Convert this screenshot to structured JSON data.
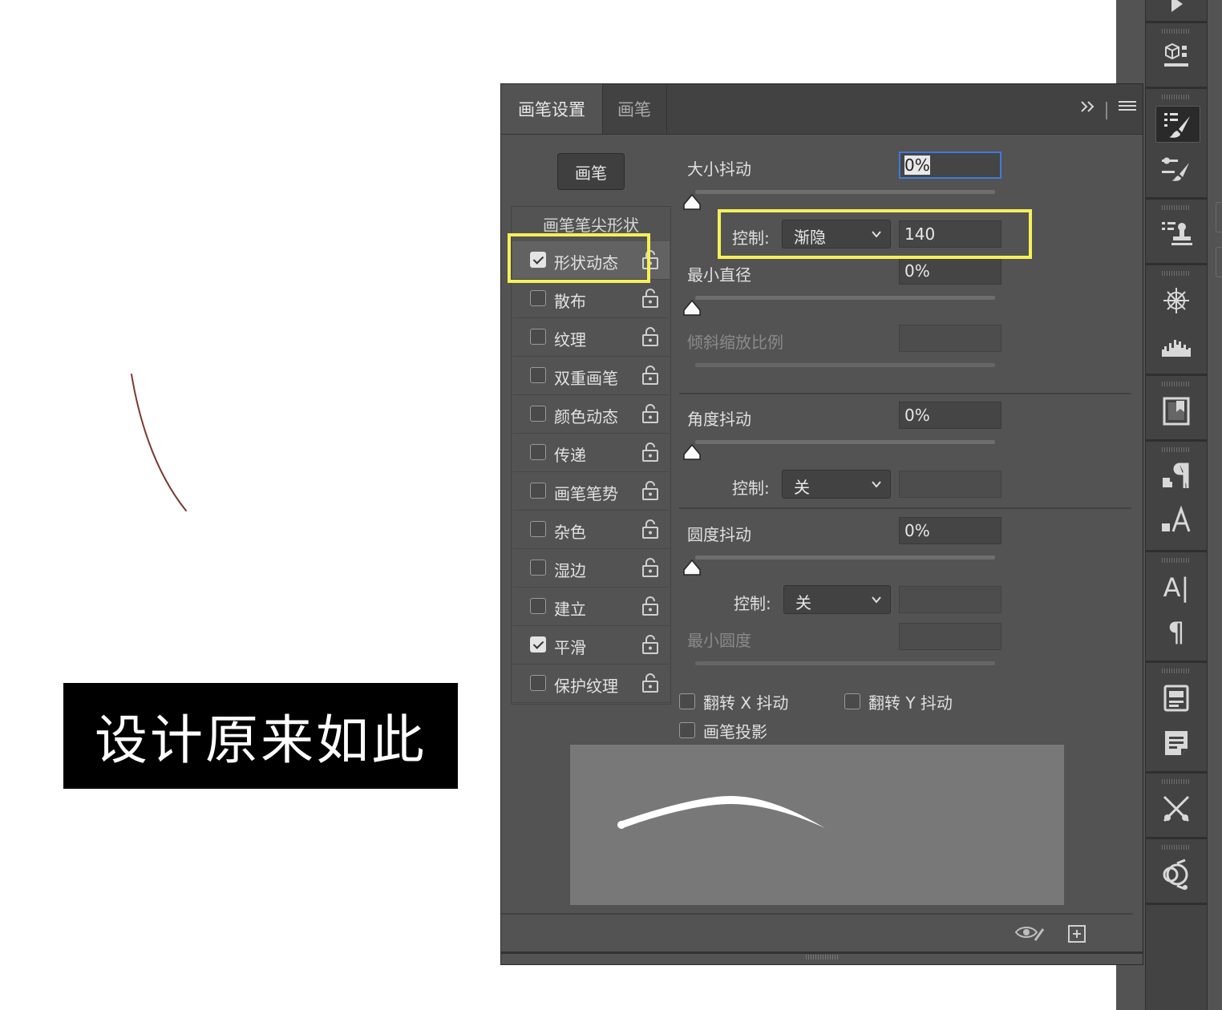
{
  "canvas": {
    "banner_text": "设计原来如此"
  },
  "panel": {
    "tabs": [
      {
        "label": "画笔设置"
      },
      {
        "label": "画笔"
      }
    ],
    "brushes_button": "画笔",
    "tip_shape_label": "画笔笔尖形状",
    "options": [
      {
        "label": "形状动态",
        "checked": true
      },
      {
        "label": "散布",
        "checked": false
      },
      {
        "label": "纹理",
        "checked": false
      },
      {
        "label": "双重画笔",
        "checked": false
      },
      {
        "label": "颜色动态",
        "checked": false
      },
      {
        "label": "传递",
        "checked": false
      },
      {
        "label": "画笔笔势",
        "checked": false
      },
      {
        "label": "杂色",
        "checked": false
      },
      {
        "label": "湿边",
        "checked": false
      },
      {
        "label": "建立",
        "checked": false
      },
      {
        "label": "平滑",
        "checked": true
      },
      {
        "label": "保护纹理",
        "checked": false
      }
    ],
    "size_jitter": {
      "label": "大小抖动",
      "value": "0%"
    },
    "size_control": {
      "label": "控制:",
      "selected": "渐隐",
      "steps": "140"
    },
    "min_diameter": {
      "label": "最小直径",
      "value": "0%"
    },
    "tilt_scale": {
      "label": "倾斜缩放比例"
    },
    "angle_jitter": {
      "label": "角度抖动",
      "value": "0%"
    },
    "angle_control": {
      "label": "控制:",
      "selected": "关"
    },
    "roundness_jitter": {
      "label": "圆度抖动",
      "value": "0%"
    },
    "roundness_control": {
      "label": "控制:",
      "selected": "关"
    },
    "min_roundness": {
      "label": "最小圆度"
    },
    "flip_x": {
      "label": "翻转 X 抖动",
      "checked": false
    },
    "flip_y": {
      "label": "翻转 Y 抖动",
      "checked": false
    },
    "brush_projection": {
      "label": "画笔投影",
      "checked": false
    }
  },
  "colors": {
    "highlight": "#f6f05a",
    "focus": "#3d7bd9",
    "stroke": "#7a3a30"
  }
}
